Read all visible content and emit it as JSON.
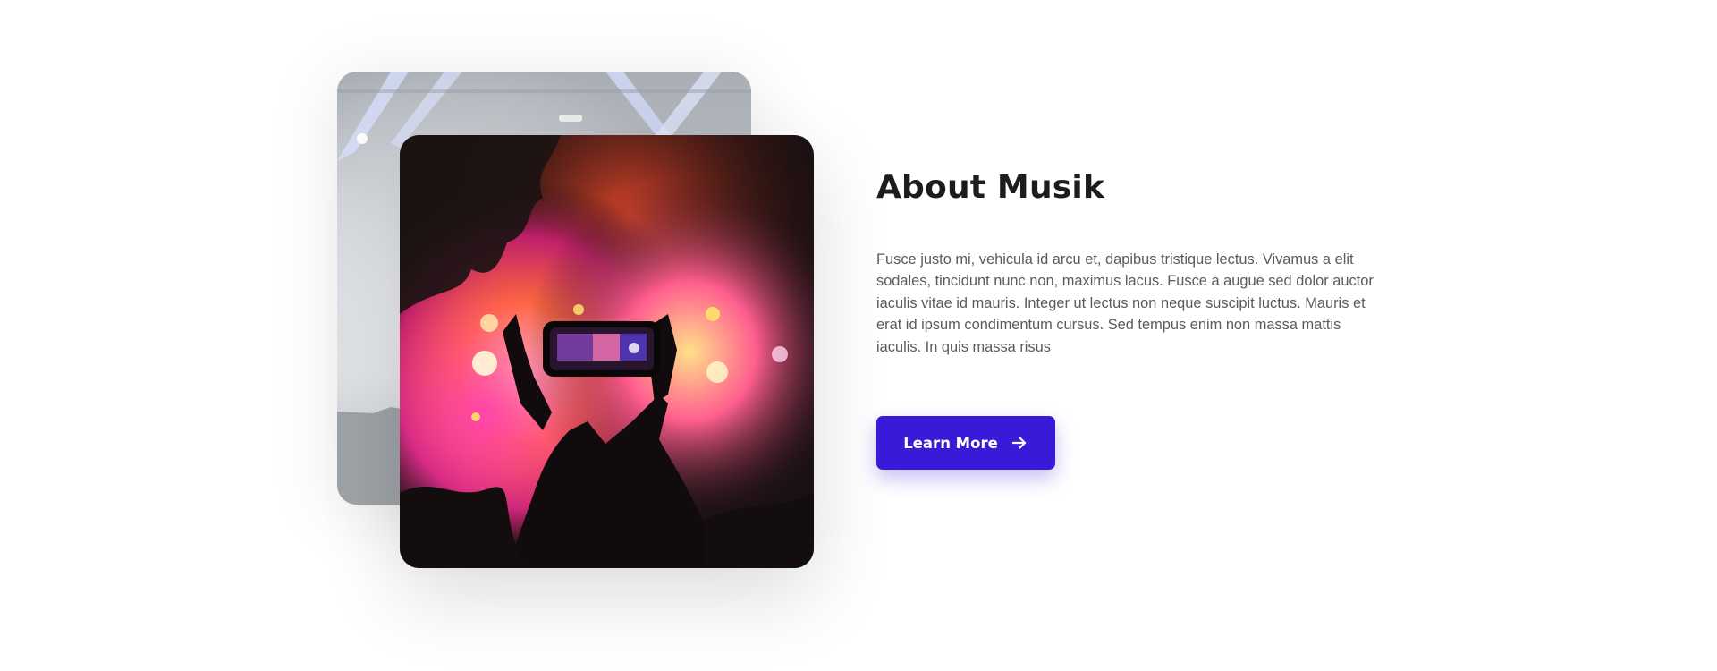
{
  "about": {
    "title": "About Musik",
    "description": "Fusce justo mi, vehicula id arcu et, dapibus tristique lectus. Vivamus a elit sodales, tincidunt nunc non, maximus lacus. Fusce a augue sed dolor auctor iaculis vitae id mauris. Integer ut lectus non neque suscipit luctus. Mauris et erat id ipsum condimentum cursus. Sed tempus enim non massa mattis iaculis. In quis massa risus",
    "button_label": "Learn More",
    "button_icon": "arrow-right-icon"
  },
  "images": {
    "back": "concert-stage-lights-photo",
    "front": "concert-crowd-phone-photo"
  },
  "colors": {
    "accent": "#3a1ad9",
    "title": "#1c1c1c",
    "body_text": "#5b5b5b",
    "background": "#ffffff"
  }
}
